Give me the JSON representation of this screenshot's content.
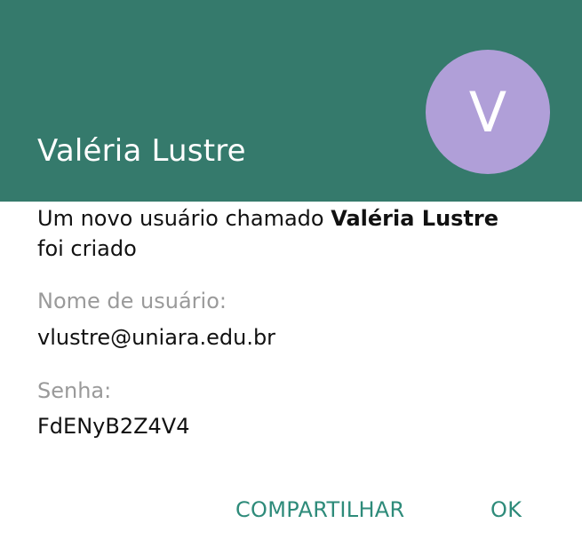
{
  "header": {
    "title": "Valéria Lustre",
    "avatar_letter": "V",
    "background_color": "#357A6C",
    "avatar_color": "#B09FD8"
  },
  "message": {
    "prefix": "Um novo usuário chamado ",
    "name": "Valéria Lustre",
    "suffix": "foi criado"
  },
  "fields": {
    "username_label": "Nome de usuário:",
    "username_value": "vlustre@uniara.edu.br",
    "password_label": "Senha:",
    "password_value": "FdENyB2Z4V4"
  },
  "actions": {
    "share_label": "COMPARTILHAR",
    "ok_label": "OK",
    "accent_color": "#2E8B7A"
  }
}
